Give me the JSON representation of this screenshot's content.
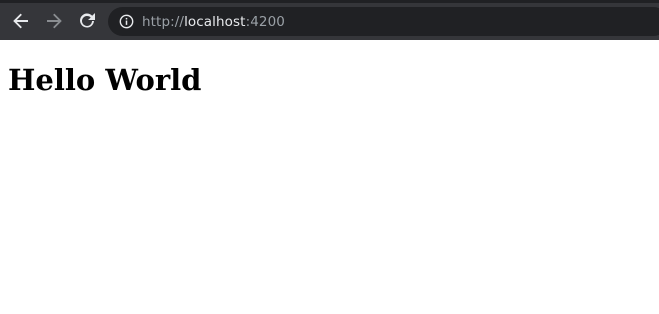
{
  "browser": {
    "toolbar_color": "#35363a",
    "omnibox_color": "#202124",
    "icons": [
      "back-arrow-icon",
      "forward-arrow-icon",
      "reload-icon",
      "info-icon"
    ],
    "address_bar": {
      "scheme": "http://",
      "host": "localhost",
      "port": ":4200"
    }
  },
  "page": {
    "heading": "Hello World",
    "background": "#ffffff"
  }
}
